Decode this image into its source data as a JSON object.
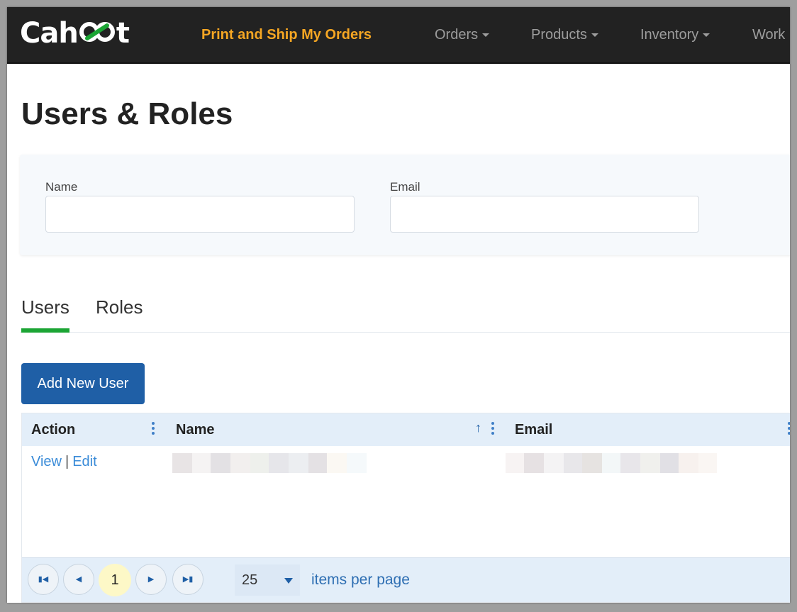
{
  "brand": {
    "name_left": "Cah",
    "name_right": "t",
    "accent": "#f5a623",
    "logo_green": "#1ba534"
  },
  "navbar": {
    "items": [
      {
        "label": "Print and Ship My Orders"
      },
      {
        "label": "Orders"
      },
      {
        "label": "Products"
      },
      {
        "label": "Inventory"
      },
      {
        "label": "Work"
      }
    ]
  },
  "page": {
    "title": "Users & Roles"
  },
  "filters": {
    "name_label": "Name",
    "name_value": "",
    "email_label": "Email",
    "email_value": ""
  },
  "tabs": [
    {
      "label": "Users"
    },
    {
      "label": "Roles"
    }
  ],
  "actions": {
    "add_user_label": "Add New User"
  },
  "grid": {
    "columns": [
      {
        "label": "Action"
      },
      {
        "label": "Name"
      },
      {
        "label": "Email"
      }
    ],
    "rows": [
      {
        "view_label": "View",
        "separator": "|",
        "edit_label": "Edit"
      }
    ]
  },
  "pager": {
    "current_page": "1",
    "page_size": "25",
    "per_page_label": "items per page"
  },
  "colors": {
    "navbar_bg": "#222222",
    "primary_button": "#1f5fa6",
    "tab_active": "#1ba534",
    "link": "#3a8bd8"
  }
}
